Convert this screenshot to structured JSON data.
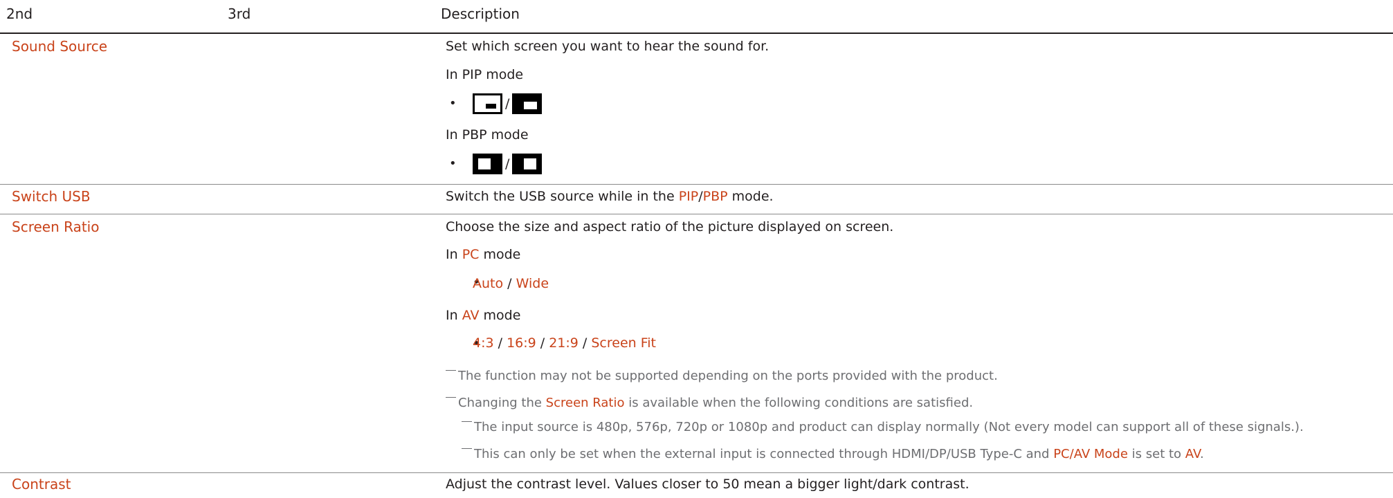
{
  "header": {
    "col2": "2nd",
    "col3": "3rd",
    "col_desc": "Description"
  },
  "rows": {
    "sound_source": {
      "label": "Sound Source",
      "desc": "Set which screen you want to hear the sound for.",
      "pip_mode": "In PIP mode",
      "pbp_mode": "In PBP mode",
      "bullet": "•",
      "separator": "/"
    },
    "switch_usb": {
      "label": "Switch USB",
      "desc_pre": "Switch the USB source while in the ",
      "pip": "PIP",
      "slash": "/",
      "pbp": "PBP",
      "desc_post": " mode."
    },
    "screen_ratio": {
      "label": "Screen Ratio",
      "desc": "Choose the size and aspect ratio of the picture displayed on screen.",
      "in": "In ",
      "pc": "PC",
      "av": "AV",
      "mode": " mode",
      "bullet": "•",
      "sep": " / ",
      "pc_opts": [
        "Auto",
        "Wide"
      ],
      "av_opts": [
        "4:3",
        "16:9",
        "21:9",
        "Screen Fit"
      ],
      "note1": "The function may not be supported depending on the ports provided with the product.",
      "note2_pre": "Changing the ",
      "note2_hl": "Screen Ratio",
      "note2_post": " is available when the following conditions are satisfied.",
      "note3": "The input source is 480p, 576p, 720p or 1080p and product can display normally (Not every model can support all of these signals.).",
      "note4_pre": "This can only be set when the external input is connected through HDMI/DP/USB Type-C and ",
      "note4_hl1": "PC/AV Mode",
      "note4_mid": " is set to ",
      "note4_hl2": "AV",
      "note4_post": "."
    },
    "contrast": {
      "label": "Contrast",
      "desc": "Adjust the contrast level. Values closer to 50 mean a bigger light/dark contrast."
    }
  },
  "icons": {
    "pip_small": "pip-small-window-icon",
    "pip_large": "pip-large-window-icon",
    "pbp_left": "pbp-left-active-icon",
    "pbp_right": "pbp-right-active-icon"
  },
  "colors": {
    "accent": "#c9431a",
    "text": "#231f20",
    "note": "#6d6e71"
  }
}
